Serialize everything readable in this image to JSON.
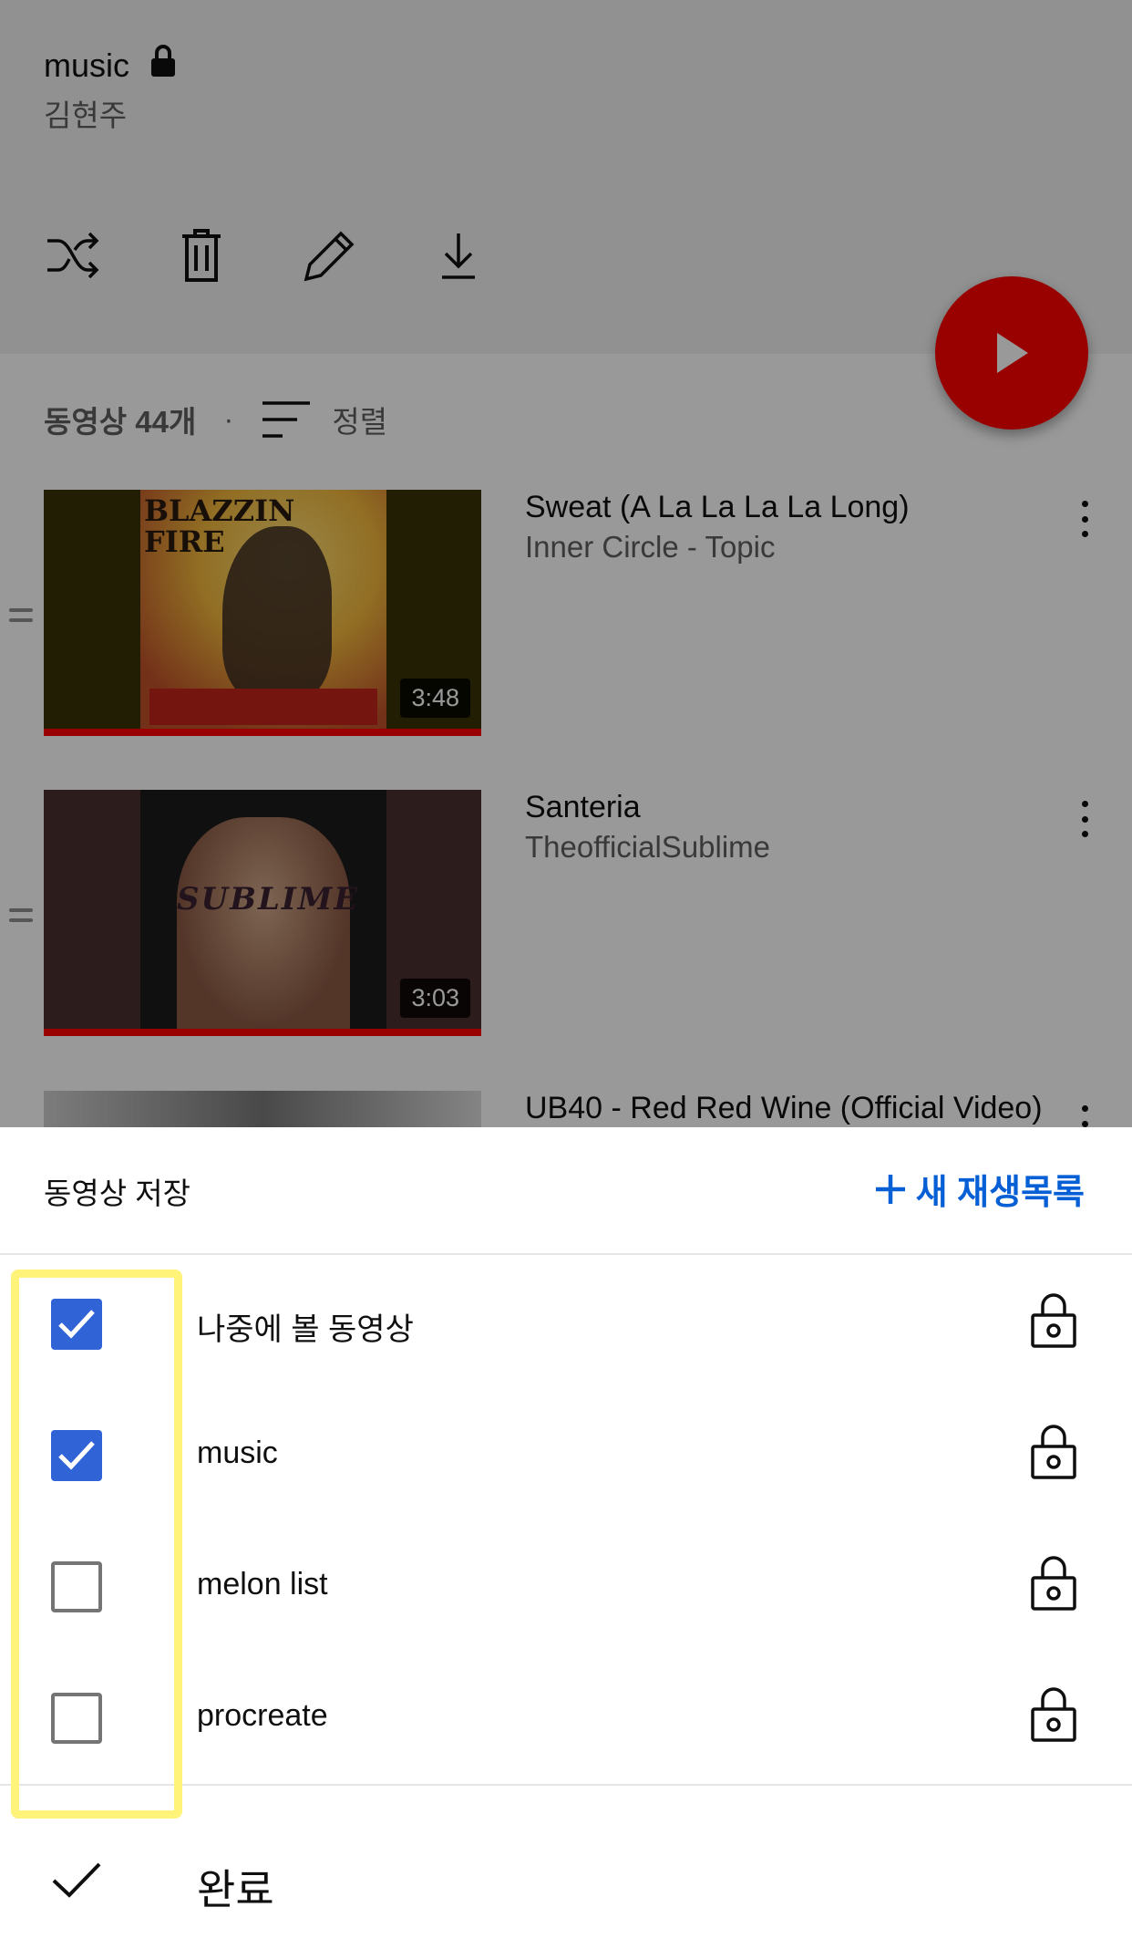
{
  "playlist": {
    "title": "music",
    "owner": "김현주",
    "video_count": "동영상 44개",
    "separator": "·",
    "sort_label": "정렬"
  },
  "actions": [
    {
      "name": "shuffle-icon"
    },
    {
      "name": "delete-icon"
    },
    {
      "name": "edit-icon"
    },
    {
      "name": "download-icon"
    }
  ],
  "videos": [
    {
      "title": "Sweat (A La La La La Long)",
      "channel": "Inner Circle - Topic",
      "duration": "3:48",
      "art_text": "BLAZZIN\nFIRE"
    },
    {
      "title": "Santeria",
      "channel": "TheofficialSublime",
      "duration": "3:03",
      "art_text": "SUBLIME"
    },
    {
      "title": "UB40 - Red Red Wine (Official Video)",
      "channel": "",
      "duration": ""
    }
  ],
  "sheet": {
    "title": "동영상 저장",
    "new_playlist": "새 재생목록",
    "playlists": [
      {
        "name": "나중에 볼 동영상",
        "checked": true
      },
      {
        "name": "music",
        "checked": true
      },
      {
        "name": "melon list",
        "checked": false
      },
      {
        "name": "procreate",
        "checked": false
      }
    ],
    "done_label": "완료"
  },
  "colors": {
    "accent_blue": "#065fd4",
    "checkbox_blue": "#2f63d6",
    "play_red": "#ff0000",
    "highlight_yellow": "#fff37a"
  }
}
